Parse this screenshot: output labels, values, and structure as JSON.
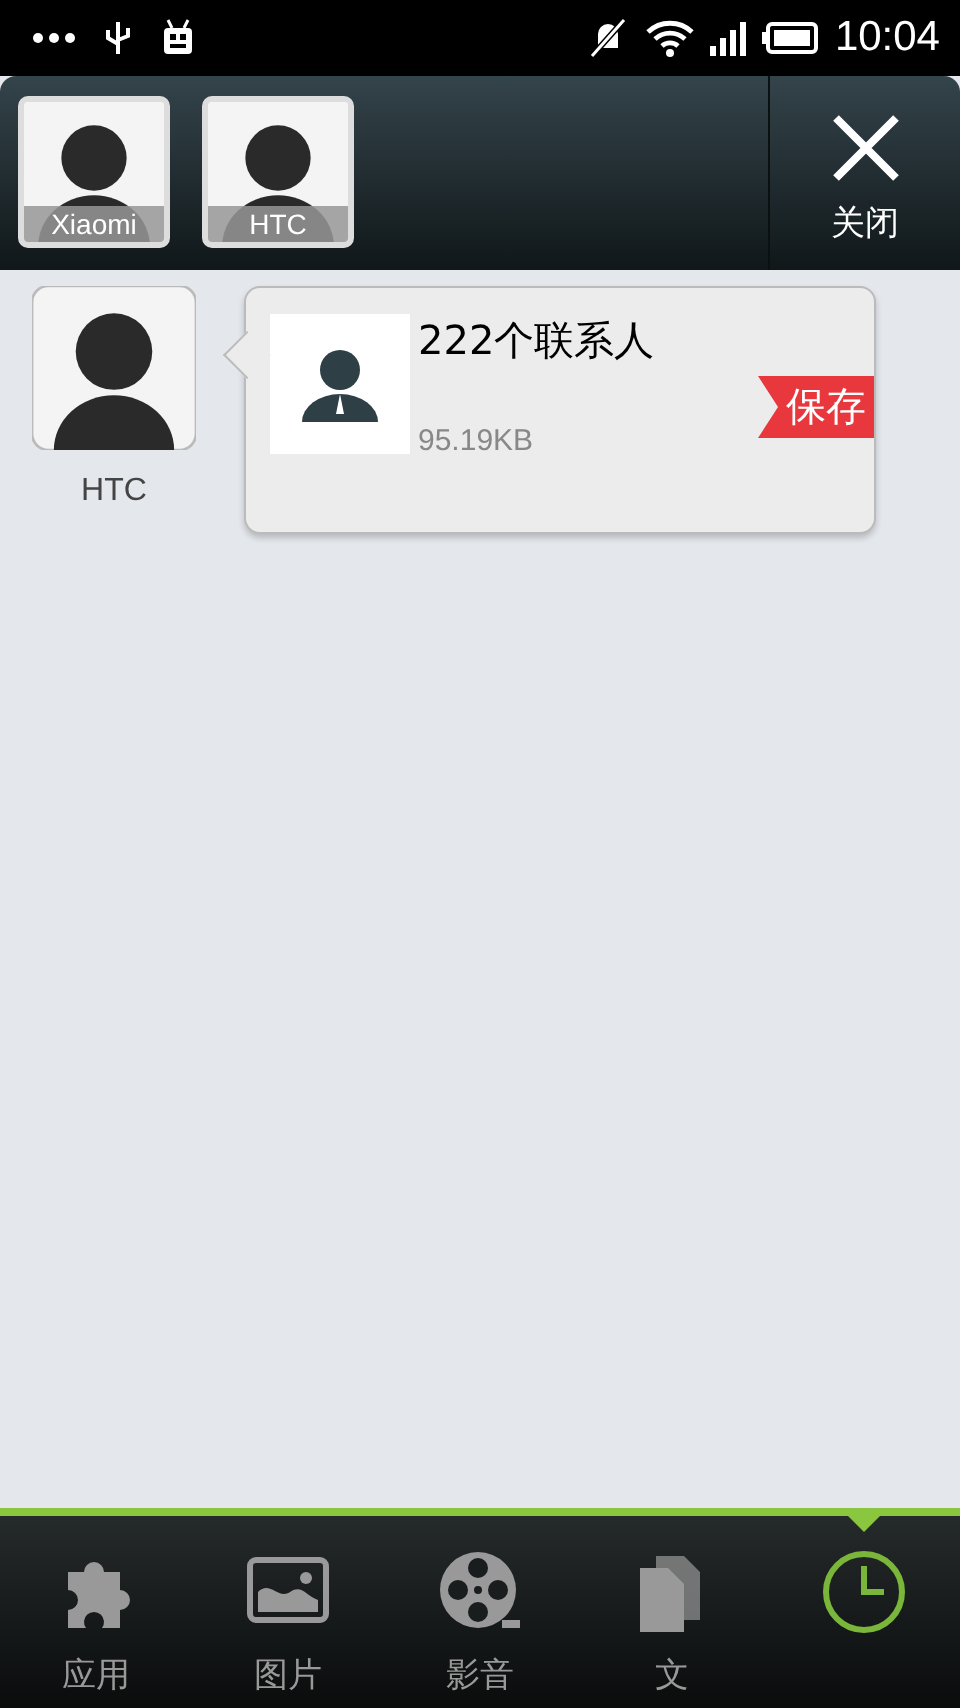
{
  "status_bar": {
    "time": "10:04"
  },
  "devices": [
    {
      "label": "Xiaomi"
    },
    {
      "label": "HTC"
    }
  ],
  "close_button": {
    "label": "关闭"
  },
  "messages": [
    {
      "sender": "HTC",
      "title": "222个联系人",
      "size": "95.19KB",
      "action": "保存"
    }
  ],
  "tabs": [
    {
      "label": "应用",
      "selected": false
    },
    {
      "label": "图片",
      "selected": false
    },
    {
      "label": "影音",
      "selected": false
    },
    {
      "label": "文",
      "selected": false
    },
    {
      "selected": true
    }
  ]
}
